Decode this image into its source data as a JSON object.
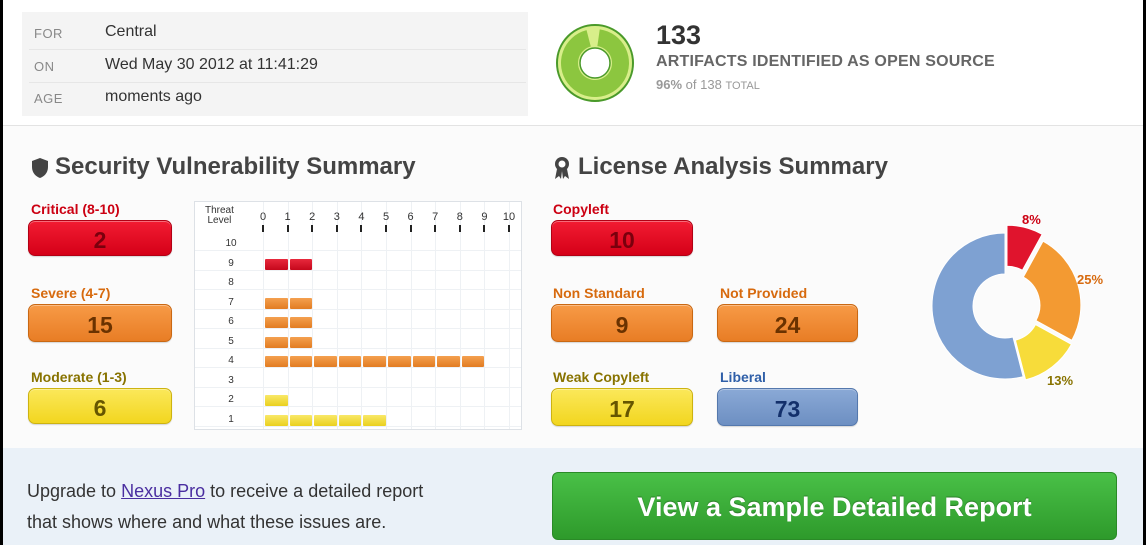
{
  "meta": [
    {
      "key": "FOR",
      "value": "Central"
    },
    {
      "key": "ON",
      "value": "Wed May 30 2012 at 11:41:29"
    },
    {
      "key": "AGE",
      "value": "moments ago"
    }
  ],
  "summary": {
    "count": "133",
    "label": "ARTIFACTS IDENTIFIED AS OPEN SOURCE",
    "percent": "96%",
    "of_text": "of 138",
    "total_text": "TOTAL",
    "ring_fraction": 0.96,
    "ring_color": "#8cc63f"
  },
  "security": {
    "title": "Security Vulnerability Summary",
    "categories": [
      {
        "label": "Critical (8-10)",
        "value": "2",
        "color": "#cc0012"
      },
      {
        "label": "Severe (4-7)",
        "value": "15",
        "color": "#d76a0e"
      },
      {
        "label": "Moderate (1-3)",
        "value": "6",
        "color": "#887300"
      }
    ],
    "threat_chart": {
      "header": [
        "Threat",
        "Level"
      ],
      "axis": [
        "0",
        "1",
        "2",
        "3",
        "4",
        "5",
        "6",
        "7",
        "8",
        "9",
        "10"
      ],
      "levels": [
        "10",
        "9",
        "8",
        "7",
        "6",
        "5",
        "4",
        "3",
        "2",
        "1"
      ],
      "bars": [
        {
          "level": "9",
          "count": 2,
          "kind": "red"
        },
        {
          "level": "7",
          "count": 2,
          "kind": "orange"
        },
        {
          "level": "6",
          "count": 2,
          "kind": "orange"
        },
        {
          "level": "5",
          "count": 2,
          "kind": "orange"
        },
        {
          "level": "4",
          "count": 9,
          "kind": "orange"
        },
        {
          "level": "2",
          "count": 1,
          "kind": "yellow"
        },
        {
          "level": "1",
          "count": 5,
          "kind": "yellow"
        }
      ]
    }
  },
  "license": {
    "title": "License Analysis Summary",
    "categories": [
      {
        "label": "Copyleft",
        "value": "10",
        "color": "#cc0012"
      },
      {
        "label": "Non Standard",
        "value": "9",
        "color": "#d76a0e"
      },
      {
        "label": "Not Provided",
        "value": "24",
        "color": "#d76a0e"
      },
      {
        "label": "Weak Copyleft",
        "value": "17",
        "color": "#887300"
      },
      {
        "label": "Liberal",
        "value": "73",
        "color": "#2f5fa8"
      }
    ],
    "donut": {
      "labels": [
        "8%",
        "25%",
        "13%"
      ],
      "segments": [
        {
          "name": "Copyleft",
          "fraction": 0.08,
          "color": "#e0142d"
        },
        {
          "name": "Not Provided",
          "fraction": 0.25,
          "color": "#f39a32"
        },
        {
          "name": "Weak Copyleft",
          "fraction": 0.13,
          "color": "#f7dc3a"
        },
        {
          "name": "Liberal",
          "fraction": 0.54,
          "color": "#7ea1d2"
        }
      ]
    }
  },
  "footer": {
    "text_before": "Upgrade to",
    "link": "Nexus Pro",
    "text_after": "to receive a detailed report",
    "text_line2": "that shows where and what these issues are.",
    "cta": "View a Sample Detailed Report"
  }
}
